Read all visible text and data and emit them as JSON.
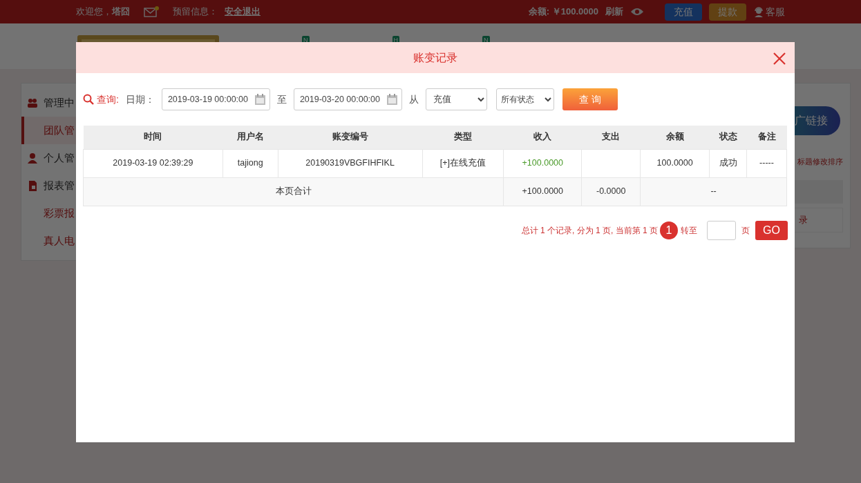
{
  "topbar": {
    "welcome": "欢迎您，",
    "user": "塔囧",
    "notice_label": "预留信息：",
    "logout": "安全退出",
    "balance": "余额: ￥100.0000",
    "refresh": "刷新",
    "deposit": "充值",
    "withdraw": "提款",
    "service": "客服"
  },
  "nav_badges": [
    "N",
    "H",
    "N"
  ],
  "sidebar": {
    "items": [
      {
        "label": "管理中",
        "kind": "group",
        "selected": false
      },
      {
        "label": "团队管",
        "kind": "sub",
        "selected": true
      },
      {
        "label": "个人管",
        "kind": "group",
        "selected": false
      },
      {
        "label": "报表管",
        "kind": "group",
        "selected": false
      },
      {
        "label": "彩票报",
        "kind": "sub",
        "selected": false
      },
      {
        "label": "真人电",
        "kind": "sub",
        "selected": false
      }
    ]
  },
  "right_panel": {
    "button": "广链接",
    "link": "标题修改排序",
    "row": "录"
  },
  "modal": {
    "title": "账变记录",
    "filter": {
      "query_label": "查询:",
      "date_label": "日期：",
      "start": "2019-03-19 00:00:00",
      "to": "至",
      "end": "2019-03-20 00:00:00",
      "from": "从",
      "type": "充值",
      "status": "所有状态",
      "search": "查 询"
    },
    "table": {
      "columns": [
        "时间",
        "用户名",
        "账变编号",
        "类型",
        "收入",
        "支出",
        "余额",
        "状态",
        "备注"
      ],
      "rows": [
        [
          "2019-03-19 02:39:29",
          "tajiong",
          "20190319VBGFIHFIKL",
          "[+]在线充值",
          "+100.0000",
          "",
          "100.0000",
          "成功",
          "-----"
        ]
      ],
      "total": {
        "label": "本页合计",
        "income": "+100.0000",
        "expense": "-0.0000",
        "balance": "--"
      }
    },
    "pagination": {
      "summary": "总计 1 个记录, 分为 1 页, 当前第 1 页",
      "pages": [
        {
          "label": "1",
          "selected": true
        }
      ],
      "goto": "转至",
      "unit": "页",
      "go": "GO"
    }
  }
}
